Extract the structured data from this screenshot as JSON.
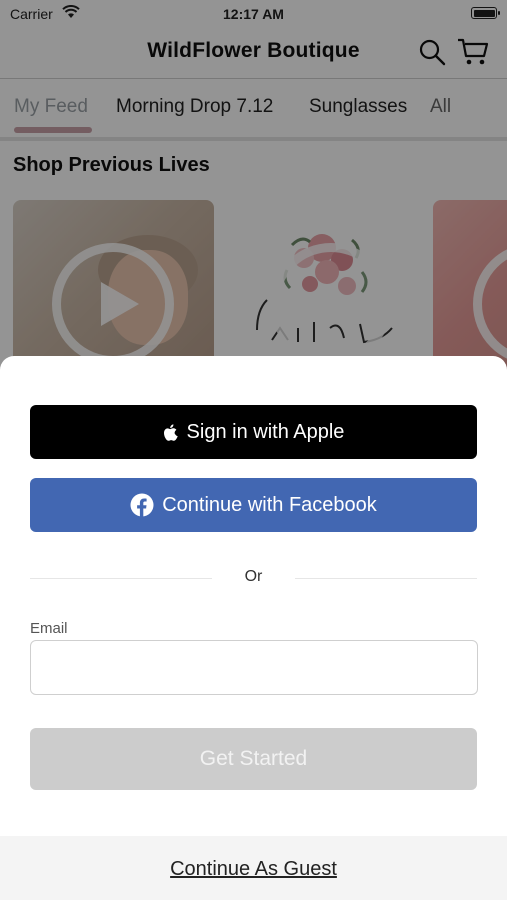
{
  "status_bar": {
    "carrier": "Carrier",
    "time": "12:17 AM"
  },
  "header": {
    "title": "WildFlower Boutique",
    "search_icon": "search-icon",
    "cart_icon": "cart-icon"
  },
  "tabs": [
    {
      "label": "My Feed",
      "active": true
    },
    {
      "label": "Morning Drop 7.12",
      "active": false
    },
    {
      "label": "Sunglasses",
      "active": false
    },
    {
      "label": "All",
      "active": false
    }
  ],
  "section": {
    "title": "Shop Previous Lives"
  },
  "colors": {
    "facebook": "#4267b2",
    "apple": "#000000",
    "tab_indicator": "#c9a0a8",
    "disabled_button": "#cccccc"
  },
  "sheet": {
    "apple_label": "Sign in with Apple",
    "facebook_label": "Continue with Facebook",
    "divider_text": "Or",
    "email_label": "Email",
    "email_value": "",
    "get_started_label": "Get Started",
    "guest_label": "Continue As Guest"
  }
}
